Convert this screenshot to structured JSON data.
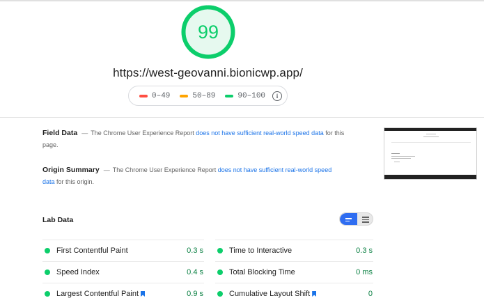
{
  "score": {
    "value": "99",
    "fraction": 0.99,
    "color": "#0cce6b"
  },
  "url": "https://west-geovanni.bionicwp.app/",
  "legend": [
    {
      "label": "0–49",
      "color": "#ff4e42"
    },
    {
      "label": "50–89",
      "color": "#ffa400"
    },
    {
      "label": "90–100",
      "color": "#0cce6b"
    }
  ],
  "info_icon": "info-icon",
  "field_data": {
    "title": "Field Data",
    "dash": "—",
    "text_before": "The Chrome User Experience Report ",
    "link": "does not have sufficient real-world speed data",
    "text_after": " for this page."
  },
  "origin_summary": {
    "title": "Origin Summary",
    "dash": "—",
    "text_before": "The Chrome User Experience Report ",
    "link": "does not have sufficient real-world speed data",
    "text_after": " for this origin."
  },
  "lab_data": {
    "title": "Lab Data",
    "metrics_left": [
      {
        "label": "First Contentful Paint",
        "value": "0.3 s",
        "bookmark": false
      },
      {
        "label": "Speed Index",
        "value": "0.4 s",
        "bookmark": false
      },
      {
        "label": "Largest Contentful Paint",
        "value": "0.9 s",
        "bookmark": true
      }
    ],
    "metrics_right": [
      {
        "label": "Time to Interactive",
        "value": "0.3 s",
        "bookmark": false
      },
      {
        "label": "Total Blocking Time",
        "value": "0 ms",
        "bookmark": false
      },
      {
        "label": "Cumulative Layout Shift",
        "value": "0",
        "bookmark": true
      }
    ]
  }
}
